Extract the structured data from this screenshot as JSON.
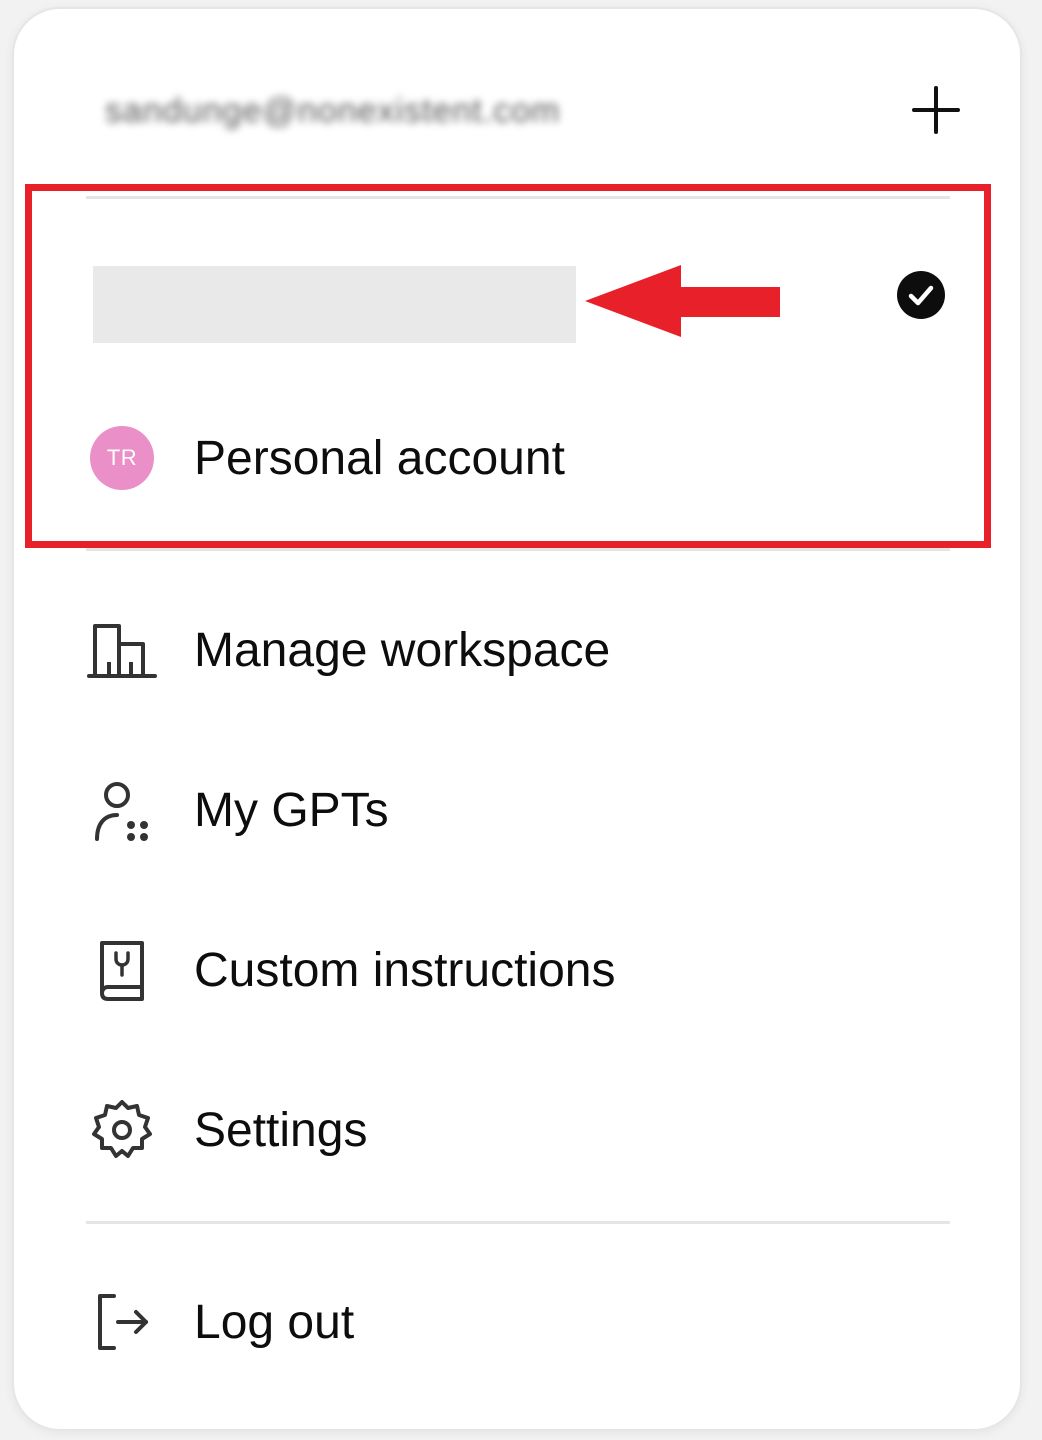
{
  "account": {
    "email": "sandunge@nonexistent.com"
  },
  "workspaces": {
    "personal_label": "Personal account",
    "avatar_initials": "TR",
    "avatar_color": "#ea8fc8"
  },
  "menu": {
    "items": [
      {
        "label": "Manage workspace",
        "icon": "building-icon"
      },
      {
        "label": "My GPTs",
        "icon": "user-apps-icon"
      },
      {
        "label": "Custom instructions",
        "icon": "instructions-book-icon"
      },
      {
        "label": "Settings",
        "icon": "gear-icon"
      }
    ],
    "logout_label": "Log out"
  },
  "annotation": {
    "color": "#e8202a"
  }
}
